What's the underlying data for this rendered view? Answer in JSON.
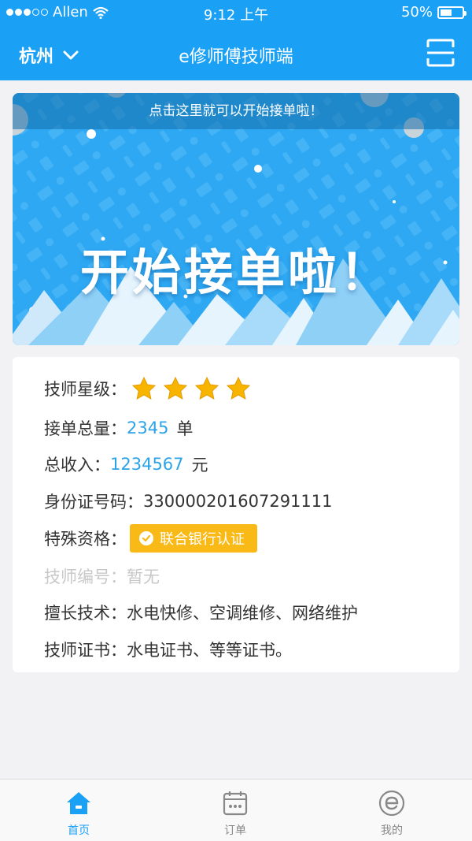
{
  "status_bar": {
    "carrier": "Allen",
    "time": "9:12 上午",
    "battery": "50%"
  },
  "navbar": {
    "city": "杭州",
    "title": "e修师傅技师端"
  },
  "banner": {
    "hint": "点击这里就可以开始接单啦！",
    "headline": "开始接单啦！"
  },
  "info": {
    "rating": {
      "label": "技师星级：",
      "stars": 4
    },
    "orders": {
      "label": "接单总量：",
      "value": "2345",
      "unit": "单"
    },
    "income": {
      "label": "总收入：",
      "value": "1234567",
      "unit": "元"
    },
    "id_number": {
      "label": "身份证号码：",
      "value": "330000201607291111"
    },
    "qualification": {
      "label": "特殊资格：",
      "badge": "联合银行认证"
    },
    "tech_number": {
      "label": "技师编号：",
      "value": "暂无"
    },
    "skills": {
      "label": "擅长技术：",
      "value": "水电快修、空调维修、网络维护"
    },
    "certificates": {
      "label": "技师证书：",
      "value": "水电证书、等等证书。"
    }
  },
  "tabbar": {
    "items": [
      {
        "label": "首页",
        "icon": "home-icon",
        "active": true
      },
      {
        "label": "订单",
        "icon": "calendar-icon",
        "active": false
      },
      {
        "label": "我的",
        "icon": "e-logo-icon",
        "active": false
      }
    ]
  },
  "colors": {
    "primary": "#1aa0f5",
    "value_blue": "#2aa3e8",
    "badge_yellow": "#f9b916",
    "star": "#f7b500"
  }
}
